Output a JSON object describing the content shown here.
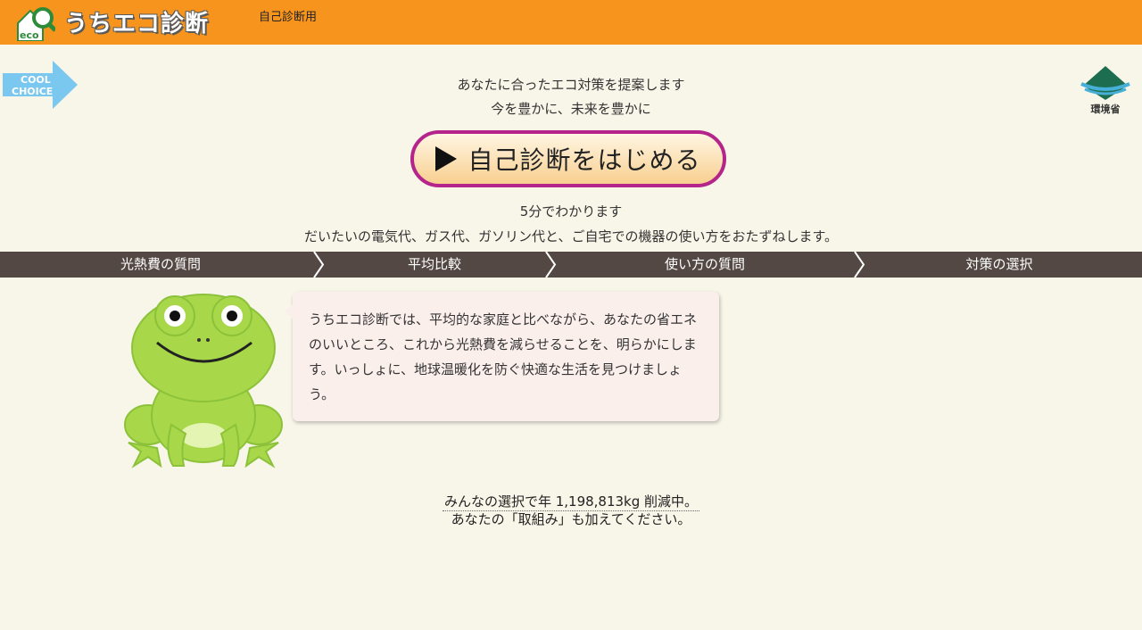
{
  "header": {
    "logo_badge": "eco",
    "app_title": "うちエコ診断",
    "subtitle": "自己診断用"
  },
  "cool_choice": {
    "line1": "COOL",
    "line2": "CHOICE"
  },
  "ministry": {
    "label": "環境省"
  },
  "intro": {
    "tagline1": "あなたに合ったエコ対策を提案します",
    "tagline2": "今を豊かに、未来を豊かに"
  },
  "start_button": {
    "label": "自己診断をはじめる"
  },
  "duration": {
    "line1": "5分でわかります",
    "line2": "だいたいの電気代、ガス代、ガソリン代と、ご自宅での機器の使い方をおたずねします。"
  },
  "steps": [
    {
      "label": "光熱費の質問"
    },
    {
      "label": "平均比較"
    },
    {
      "label": "使い方の質問"
    },
    {
      "label": "対策の選択"
    }
  ],
  "bubble": {
    "text": "うちエコ診断では、平均的な家庭と比べながら、あなたの省エネのいいところ、これから光熱費を減らせることを、明らかにします。いっしょに、地球温暖化を防ぐ快適な生活を見つけましょう。"
  },
  "stats": {
    "line1": "みんなの選択で年 1,198,813kg 削減中。",
    "line2": "あなたの「取組み」も加えてください。"
  },
  "colors": {
    "header_bg": "#f7941d",
    "page_bg": "#f8f6e9",
    "steps_bg": "#534843",
    "button_border": "#b5248b",
    "frog_green": "#a8d84a"
  }
}
